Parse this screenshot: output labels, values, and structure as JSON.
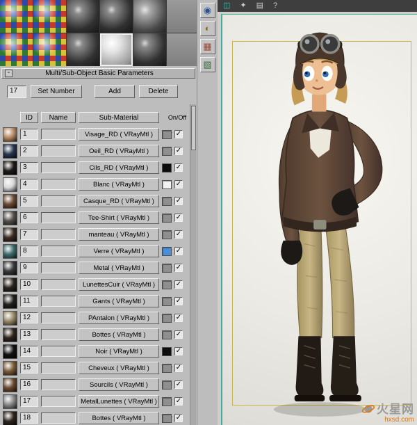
{
  "editor": {
    "rollout": {
      "title": "Multi/Sub-Object Basic Parameters",
      "collapse_glyph": "-"
    },
    "count_field": "17",
    "buttons": {
      "set_number": "Set Number",
      "add": "Add",
      "delete": "Delete"
    },
    "columns": {
      "id": "ID",
      "name": "Name",
      "sub_material": "Sub-Material",
      "on_off": "On/Off"
    },
    "check_glyph": "✓",
    "sample_slots": [
      {
        "type": "checker"
      },
      {
        "type": "checker"
      },
      {
        "type": "dark"
      },
      {
        "type": "dark"
      },
      {
        "type": "darkgray"
      },
      {
        "type": "gray"
      },
      {
        "type": "checker"
      },
      {
        "type": "checker"
      },
      {
        "type": "dark"
      },
      {
        "type": "white",
        "active": true
      },
      {
        "type": "dark"
      },
      {
        "type": "gray"
      }
    ],
    "side_tools": [
      {
        "name": "sample-type-icon",
        "glyph": "◉",
        "color": "#2a4f8f"
      },
      {
        "name": "backlight-icon",
        "glyph": "◐",
        "color": "#8a6a20"
      },
      {
        "name": "background-icon",
        "glyph": "▦",
        "color": "#b04030"
      },
      {
        "name": "options-icon",
        "glyph": "▧",
        "color": "#3a6a3a"
      }
    ],
    "materials": [
      {
        "id": "1",
        "label": "Visage_RD  ( VRayMtl )",
        "thumb": "#b98a63",
        "swatch": "#8f8f8f",
        "checked": true
      },
      {
        "id": "2",
        "label": "Oeil_RD  ( VRayMtl )",
        "thumb": "#2a3550",
        "swatch": "#8f8f8f",
        "checked": true
      },
      {
        "id": "3",
        "label": "Cils_RD  ( VRayMtl )",
        "thumb": "#1f1b18",
        "swatch": "#0d0d0d",
        "checked": true
      },
      {
        "id": "4",
        "label": "Blanc  ( VRayMtl )",
        "thumb": "#d8d8d8",
        "swatch": "#f2f2f2",
        "checked": true
      },
      {
        "id": "5",
        "label": "Casque_RD  ( VRayMtl )",
        "thumb": "#6b4a33",
        "swatch": "#8f8f8f",
        "checked": true
      },
      {
        "id": "6",
        "label": "Tee-Shirt  ( VRayMtl )",
        "thumb": "#55504a",
        "swatch": "#8f8f8f",
        "checked": true
      },
      {
        "id": "7",
        "label": "manteau  ( VRayMtl )",
        "thumb": "#3a2c22",
        "swatch": "#8f8f8f",
        "checked": true
      },
      {
        "id": "8",
        "label": "Verre  ( VRayMtl )",
        "thumb": "#3d6b6b",
        "swatch": "#4a90d9",
        "checked": true
      },
      {
        "id": "9",
        "label": "Metal  ( VRayMtl )",
        "thumb": "#3a3a3e",
        "swatch": "#8f8f8f",
        "checked": true
      },
      {
        "id": "10",
        "label": "LunettesCuir  ( VRayMtl )",
        "thumb": "#2b241e",
        "swatch": "#8f8f8f",
        "checked": true
      },
      {
        "id": "11",
        "label": "Gants  ( VRayMtl )",
        "thumb": "#23201c",
        "swatch": "#8f8f8f",
        "checked": true
      },
      {
        "id": "12",
        "label": "PAntalon  ( VRayMtl )",
        "thumb": "#9a8a68",
        "swatch": "#8f8f8f",
        "checked": true
      },
      {
        "id": "13",
        "label": "Bottes  ( VRayMtl )",
        "thumb": "#2e241c",
        "swatch": "#8f8f8f",
        "checked": true
      },
      {
        "id": "14",
        "label": "Noir  ( VRayMtl )",
        "thumb": "#121212",
        "swatch": "#0d0d0d",
        "checked": true
      },
      {
        "id": "15",
        "label": "Cheveux  ( VRayMtl )",
        "thumb": "#7a5c38",
        "swatch": "#8f8f8f",
        "checked": true
      },
      {
        "id": "16",
        "label": "Sourcils  ( VRayMtl )",
        "thumb": "#6a4a2e",
        "swatch": "#8f8f8f",
        "checked": true
      },
      {
        "id": "17",
        "label": "MetalLunettes  ( VRayMtl )",
        "thumb": "#8a8a8a",
        "swatch": "#8f8f8f",
        "checked": true
      },
      {
        "id": "18",
        "label": "Bottes  ( VRayMtl )",
        "thumb": "#2e241c",
        "swatch": "#8f8f8f",
        "checked": true
      }
    ]
  },
  "viewport": {
    "toolbar_icons": [
      {
        "name": "schematic-view-icon",
        "glyph": "◫"
      },
      {
        "name": "render-setup-icon",
        "glyph": "✦"
      },
      {
        "name": "layers-icon",
        "glyph": "▤"
      },
      {
        "name": "help-icon",
        "glyph": "?"
      }
    ],
    "frame_color": "#c9b54b",
    "edge_color": "#3fae9f"
  },
  "watermark": {
    "brand": "火星网",
    "domain": "hxsd.com",
    "accent": "#e07818"
  }
}
